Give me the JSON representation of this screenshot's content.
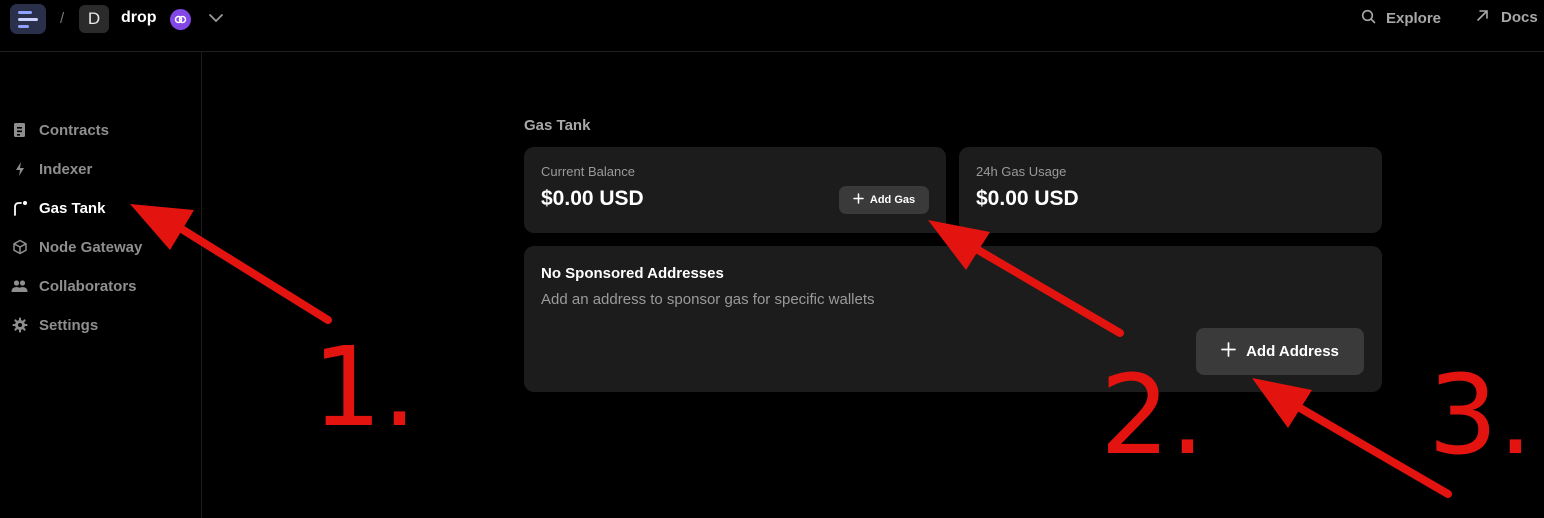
{
  "colors": {
    "background": "#000000",
    "card": "#1c1c1c",
    "button": "#3a3a3a",
    "annotation": "#e3140f",
    "chain_badge": "#8247e5"
  },
  "header": {
    "breadcrumb_separator": "/",
    "avatar_letter": "D",
    "project_name": "drop",
    "icons": [
      "app-logo-icon",
      "polygon-chain-icon",
      "chevron-down-icon",
      "search-icon",
      "arrow-up-right-icon"
    ],
    "explore_label": "Explore",
    "docs_label": "Docs"
  },
  "sidebar": {
    "items": [
      {
        "label": "Contracts",
        "icon": "document-icon",
        "active": false
      },
      {
        "label": "Indexer",
        "icon": "lightning-icon",
        "active": false
      },
      {
        "label": "Gas Tank",
        "icon": "gas-path-icon",
        "active": true
      },
      {
        "label": "Node Gateway",
        "icon": "cube-icon",
        "active": false
      },
      {
        "label": "Collaborators",
        "icon": "users-icon",
        "active": false
      },
      {
        "label": "Settings",
        "icon": "gear-icon",
        "active": false
      }
    ]
  },
  "main": {
    "section_title": "Gas Tank",
    "balance_card": {
      "label": "Current Balance",
      "value": "$0.00 USD",
      "button_label": "Add Gas"
    },
    "usage_card": {
      "label": "24h Gas Usage",
      "value": "$0.00 USD"
    },
    "sponsored_card": {
      "title": "No Sponsored Addresses",
      "description": "Add an address to sponsor gas for specific wallets",
      "button_label": "Add Address"
    }
  },
  "annotations": {
    "step_1": "1.",
    "step_2": "2.",
    "step_3": "3."
  }
}
